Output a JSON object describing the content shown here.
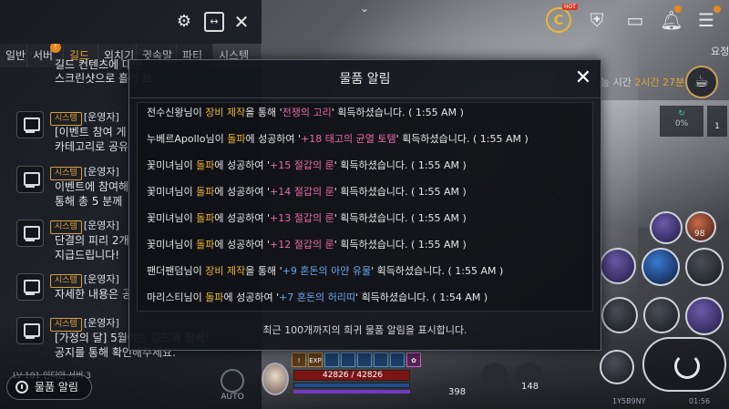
{
  "modal": {
    "title": "물품 알림",
    "close_icon": "✕",
    "footer": "최근 100개까지의 희귀 물품 알림을 표시합니다.",
    "notices": [
      {
        "name": "전수신왕",
        "join": "님이 ",
        "action": "장비 제작",
        "mid": "을 통해 '",
        "item": "전쟁의 고리",
        "end": "' 획득하셨습니다. ( 1:55 AM )",
        "color": "pink"
      },
      {
        "name": "누베르Apollo",
        "join": "님이 ",
        "action": "돌파",
        "mid": "에 성공하여 '",
        "item": "+18 태고의 균열 토템",
        "end": "' 획득하셨습니다. ( 1:55 AM )",
        "color": "pink"
      },
      {
        "name": "꽃미녀",
        "join": "님이 ",
        "action": "돌파",
        "mid": "에 성공하여 '",
        "item": "+15 절갑의 룬",
        "end": "' 획득하셨습니다. ( 1:55 AM )",
        "color": "pink"
      },
      {
        "name": "꽃미녀",
        "join": "님이 ",
        "action": "돌파",
        "mid": "에 성공하여 '",
        "item": "+14 절갑의 룬",
        "end": "' 획득하셨습니다. ( 1:55 AM )",
        "color": "pink"
      },
      {
        "name": "꽃미녀",
        "join": "님이 ",
        "action": "돌파",
        "mid": "에 성공하여 '",
        "item": "+13 절갑의 룬",
        "end": "' 획득하셨습니다. ( 1:55 AM )",
        "color": "pink"
      },
      {
        "name": "꽃미녀",
        "join": "님이 ",
        "action": "돌파",
        "mid": "에 성공하여 '",
        "item": "+12 절갑의 룬",
        "end": "' 획득하셨습니다. ( 1:55 AM )",
        "color": "pink"
      },
      {
        "name": "팬더팬덤",
        "join": "님이 ",
        "action": "장비 제작",
        "mid": "을 통해 '",
        "item": "+9 혼돈의 아얀 유물",
        "end": "' 획득하셨습니다. ( 1:55 AM )",
        "color": "blue"
      },
      {
        "name": "마리스티",
        "join": "님이 ",
        "action": "돌파",
        "mid": "에 성공하여 '",
        "item": "+7 혼돈의 허리띠",
        "end": "' 획득하셨습니다. ( 1:54 AM )",
        "color": "blue"
      }
    ]
  },
  "chat": {
    "tabs": [
      "일반",
      "서버",
      "길드",
      "외치기",
      "귓속말",
      "파티",
      "시스템"
    ],
    "system_badge": "시스템",
    "sender": "[운영자]",
    "messages": [
      {
        "lines": [
          "길드 컨텐츠에 대한",
          "스크린샷으로 흘러 보"
        ],
        "show_meta": false
      },
      {
        "lines": [
          "[이벤트 참여 게",
          "카테고리로 공유"
        ],
        "show_meta": true
      },
      {
        "lines": [
          "이벤트에 참여해",
          "통해 총 5 분께"
        ],
        "show_meta": true
      },
      {
        "lines": [
          "단결의 피리 2개",
          "지급드립니다!"
        ],
        "show_meta": true
      },
      {
        "lines": [
          "자세한 내용은 공"
        ],
        "show_meta": true
      },
      {
        "lines": [
          "[가정의 달] 5월에는 길드와 함께!",
          "공지를 통해 확인해주세요."
        ],
        "show_meta": true
      }
    ],
    "level_text": "LV 101  인디안 서버 3",
    "item_alert_button": "물품 알림",
    "auto_label": "AUTO"
  },
  "hud": {
    "top_chevron": "⌄",
    "coin_symbol": "C",
    "hot_badge": "HOT",
    "summary": "요정",
    "time_label": "능 시간",
    "time_value": "2시간 27분",
    "quest_pct": "0%",
    "quest_count": "1",
    "skill_count": "98",
    "hp_text": "42826 / 42826",
    "buffs": [
      "!",
      "EXP",
      "",
      "",
      "",
      "",
      "",
      "✿"
    ],
    "potion_count_1": "398",
    "potion_count_2": "148",
    "sys_info": "1Y5B9NY",
    "clock": "01:56"
  }
}
